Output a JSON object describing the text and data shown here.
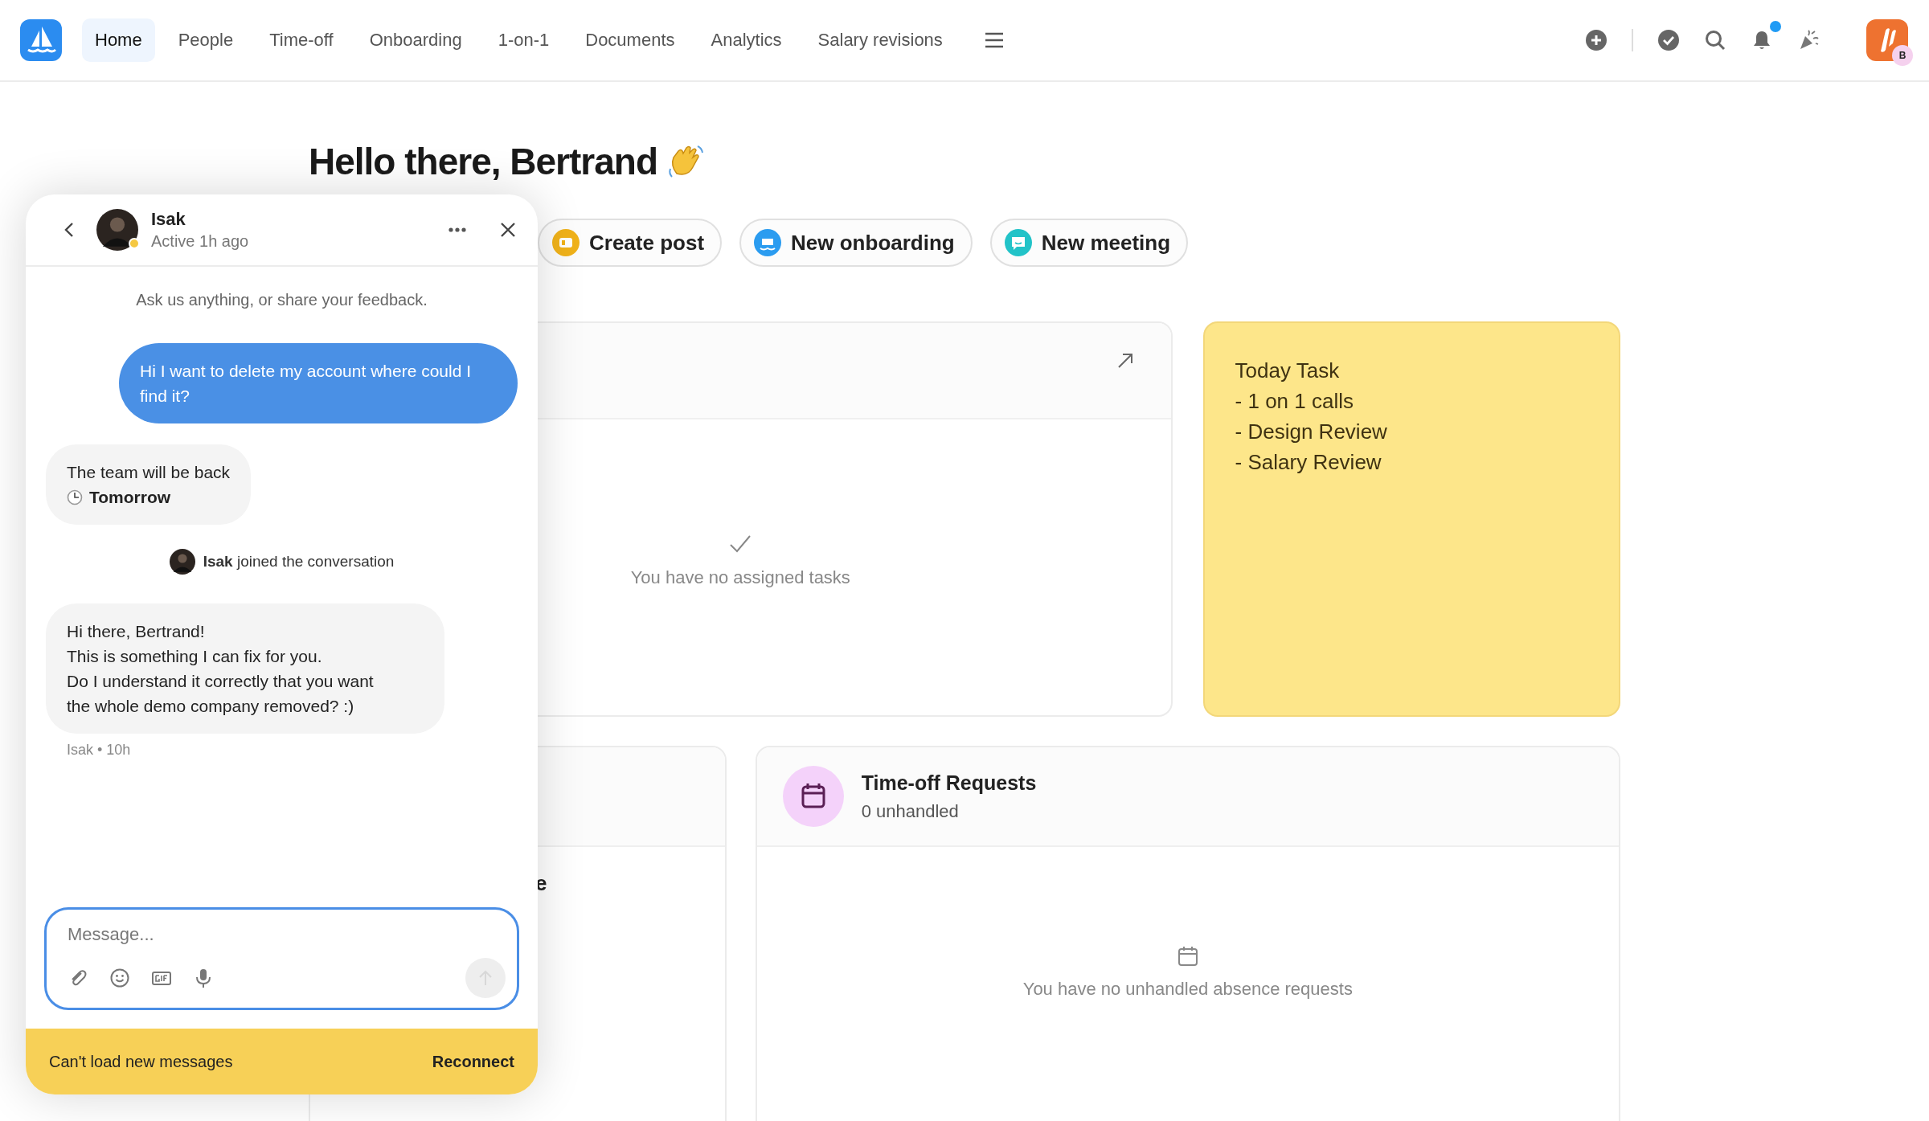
{
  "nav": {
    "tabs": [
      {
        "label": "Home",
        "selected": true
      },
      {
        "label": "People",
        "selected": false
      },
      {
        "label": "Time-off",
        "selected": false
      },
      {
        "label": "Onboarding",
        "selected": false
      },
      {
        "label": "1-on-1",
        "selected": false
      },
      {
        "label": "Documents",
        "selected": false
      },
      {
        "label": "Analytics",
        "selected": false
      },
      {
        "label": "Salary revisions",
        "selected": false
      }
    ],
    "notifications_unread": true,
    "avatar_badge": "B"
  },
  "greeting": "Hello there, Bertrand",
  "quick_actions": [
    {
      "label": "Create post",
      "kind": "post"
    },
    {
      "label": "New onboarding",
      "kind": "onboarding"
    },
    {
      "label": "New meeting",
      "kind": "meeting"
    }
  ],
  "tasks_card": {
    "empty_text": "You have no assigned tasks"
  },
  "sticky_note": {
    "lines": [
      "Today Task",
      "- 1 on 1 calls",
      "- Design Review",
      "- Salary Review"
    ]
  },
  "hidden_card": {
    "title_fragment": "e"
  },
  "timeoff_card": {
    "title": "Time-off Requests",
    "subtitle": "0 unhandled",
    "empty_text": "You have no unhandled absence requests"
  },
  "chat": {
    "name": "Isak",
    "status": "Active 1h ago",
    "intro": "Ask us anything, or share your feedback.",
    "messages": [
      {
        "kind": "outgoing",
        "text": "Hi I want to delete my account where could I find it?"
      },
      {
        "kind": "away",
        "text": "The team will be back",
        "back": "Tomorrow"
      },
      {
        "kind": "event",
        "text": "**Isak** joined the conversation"
      },
      {
        "kind": "incoming",
        "lines": [
          "Hi there, Bertrand!",
          "This is something I can fix for you.",
          "Do I understand it correctly that you want",
          "the whole demo company removed? :)"
        ],
        "meta": "Isak • 10h"
      }
    ],
    "composer": {
      "placeholder": "Message..."
    },
    "banner": {
      "text": "Can't load new messages",
      "action": "Reconnect"
    }
  }
}
